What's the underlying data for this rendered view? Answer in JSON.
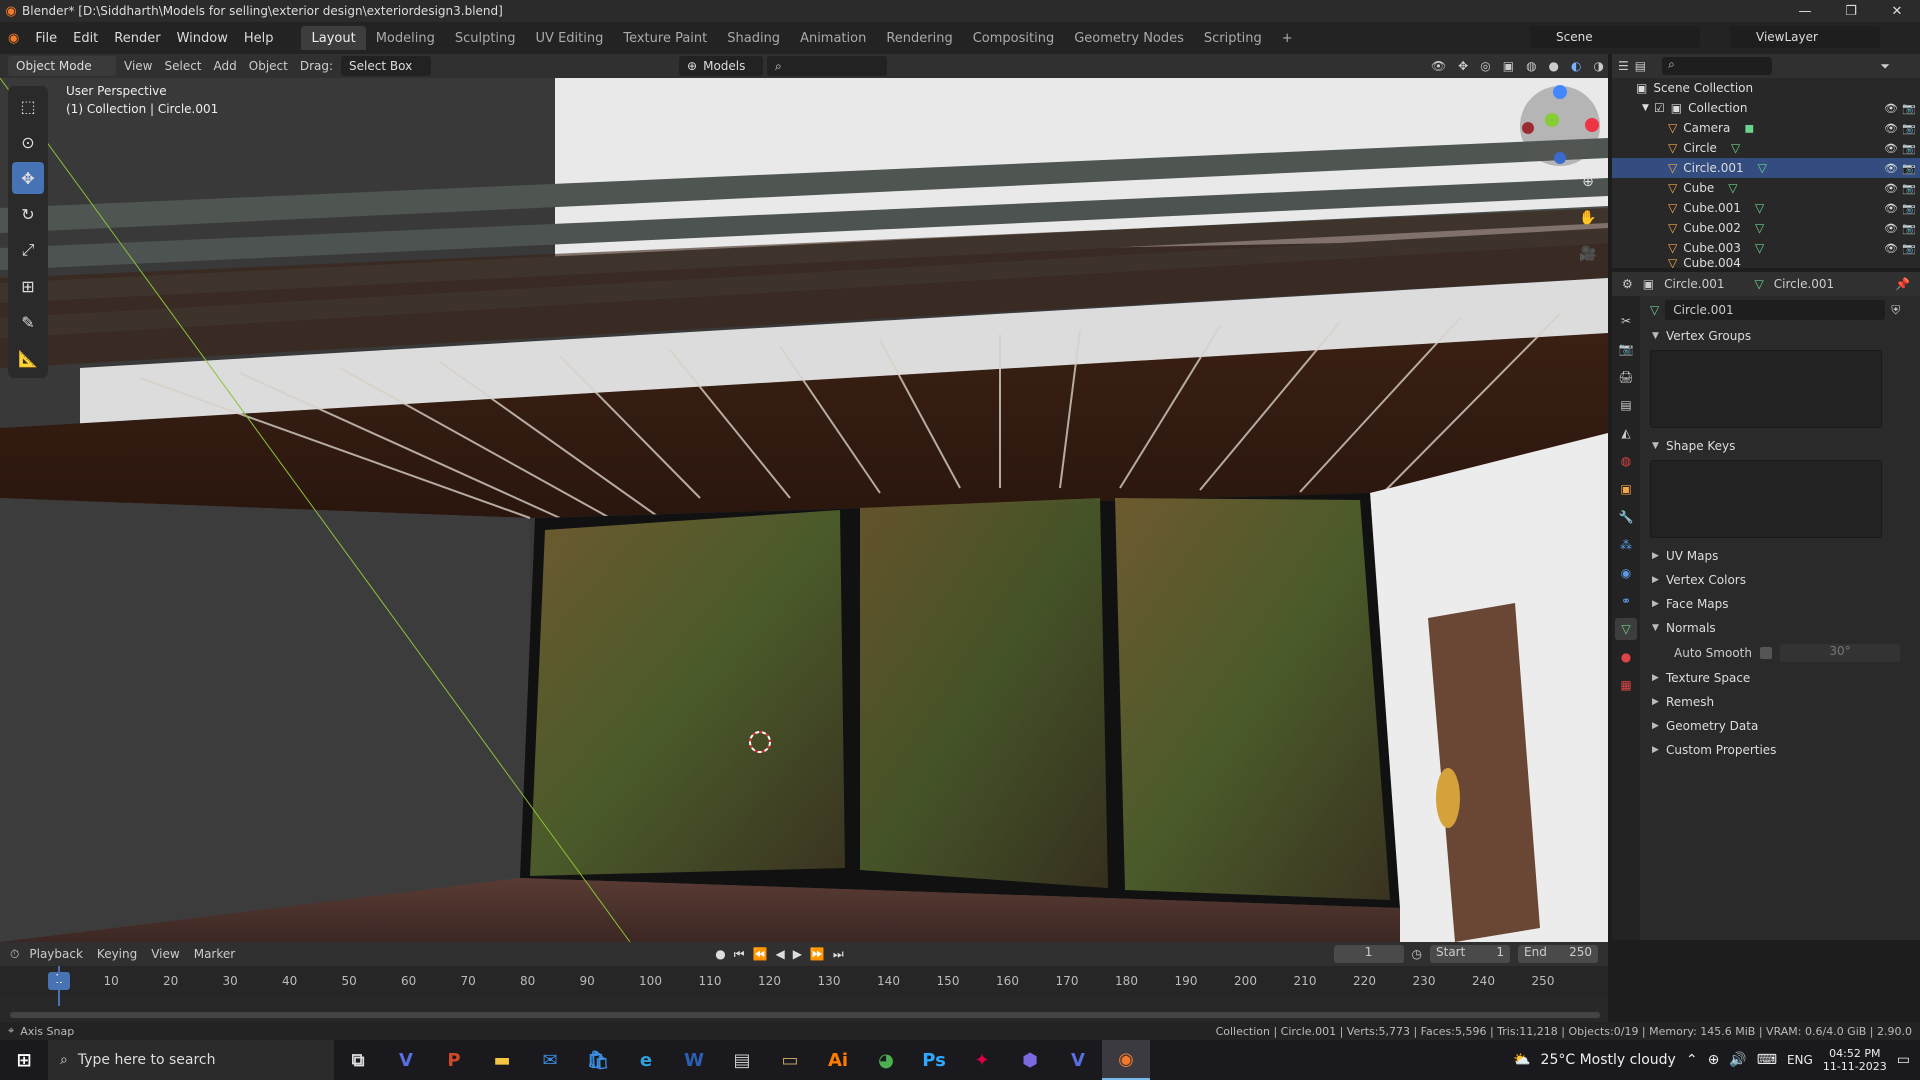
{
  "window": {
    "title": "Blender* [D:\\Siddharth\\Models for selling\\exterior design\\exteriordesign3.blend]",
    "controls": [
      "—",
      "❐",
      "✕"
    ]
  },
  "menubar": {
    "items": [
      "File",
      "Edit",
      "Render",
      "Window",
      "Help"
    ],
    "workspaces": [
      "Layout",
      "Modeling",
      "Sculpting",
      "UV Editing",
      "Texture Paint",
      "Shading",
      "Animation",
      "Rendering",
      "Compositing",
      "Geometry Nodes",
      "Scripting"
    ],
    "active_workspace": "Layout",
    "scene": "Scene",
    "view_layer": "ViewLayer"
  },
  "header3d": {
    "mode": "Object Mode",
    "items": [
      "View",
      "Select",
      "Add",
      "Object"
    ],
    "drag_label": "Drag:",
    "drag_value": "Select Box",
    "orientation": "Models"
  },
  "viewport": {
    "perspective": "User Perspective",
    "collection_info": "(1) Collection | Circle.001"
  },
  "outliner": {
    "root": "Scene Collection",
    "collection": "Collection",
    "objects": [
      "Camera",
      "Circle",
      "Circle.001",
      "Cube",
      "Cube.001",
      "Cube.002",
      "Cube.003",
      "Cube.004"
    ],
    "selected": "Circle.001"
  },
  "properties": {
    "object": "Circle.001",
    "data": "Circle.001",
    "mesh_name": "Circle.001",
    "panels": [
      {
        "title": "Vertex Groups",
        "open": true
      },
      {
        "title": "Shape Keys",
        "open": true
      },
      {
        "title": "UV Maps",
        "open": false
      },
      {
        "title": "Vertex Colors",
        "open": false
      },
      {
        "title": "Face Maps",
        "open": false
      },
      {
        "title": "Normals",
        "open": true
      },
      {
        "title": "Texture Space",
        "open": false
      },
      {
        "title": "Remesh",
        "open": false
      },
      {
        "title": "Geometry Data",
        "open": false
      },
      {
        "title": "Custom Properties",
        "open": false
      }
    ],
    "auto_smooth_label": "Auto Smooth",
    "auto_smooth_angle": "30°"
  },
  "timeline": {
    "menus": [
      "Playback",
      "Keying",
      "View",
      "Marker"
    ],
    "current_frame": "1",
    "start_label": "Start",
    "start": "1",
    "end_label": "End",
    "end": "250",
    "ticks": [
      "1",
      "10",
      "20",
      "30",
      "40",
      "50",
      "60",
      "70",
      "80",
      "90",
      "100",
      "110",
      "120",
      "130",
      "140",
      "150",
      "160",
      "170",
      "180",
      "190",
      "200",
      "210",
      "220",
      "230",
      "240",
      "250"
    ]
  },
  "statusbar": {
    "left": "Axis Snap",
    "right": "Collection | Circle.001 | Verts:5,773 | Faces:5,596 | Tris:11,218 | Objects:0/19 | Memory: 145.6 MiB | VRAM: 0.6/4.0 GiB | 2.90.0"
  },
  "taskbar": {
    "search_placeholder": "Type here to search",
    "weather": "25°C  Mostly cloudy",
    "lang": "ENG",
    "time": "04:52 PM",
    "date": "11-11-2023",
    "apps": [
      "task-view",
      "vivaldi",
      "powerpoint",
      "file-explorer",
      "mail",
      "store",
      "edge",
      "word",
      "notepad",
      "folder",
      "illustrator",
      "chrome",
      "photoshop",
      "generic",
      "ovito",
      "vivaldi2",
      "blender"
    ]
  }
}
